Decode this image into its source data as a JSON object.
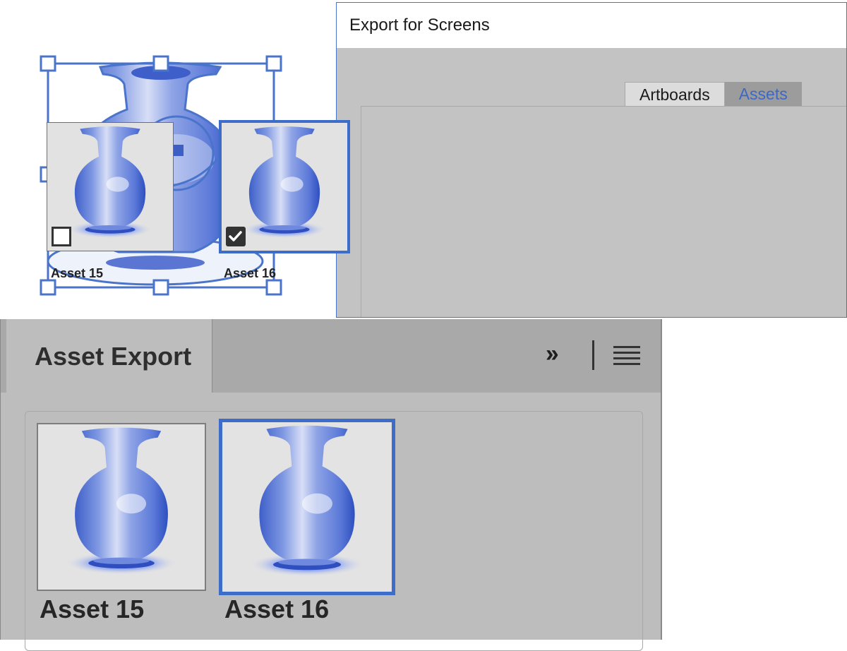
{
  "dialog": {
    "title": "Export for Screens",
    "tabs": [
      {
        "label": "Artboards",
        "active": false
      },
      {
        "label": "Assets",
        "active": true
      }
    ],
    "assets": [
      {
        "label": "Asset 15",
        "checked": false
      },
      {
        "label": "Asset 16",
        "checked": true
      }
    ]
  },
  "panel": {
    "title": "Asset Export",
    "assets": [
      {
        "label": "Asset 15",
        "selected": false
      },
      {
        "label": "Asset 16",
        "selected": true
      }
    ]
  },
  "colors": {
    "accent": "#3d6dc8",
    "selection": "#4a74c9",
    "vase": "#5a7fd6",
    "panel_bg": "#bdbdbd",
    "dialog_bg": "#c3c3c3"
  }
}
